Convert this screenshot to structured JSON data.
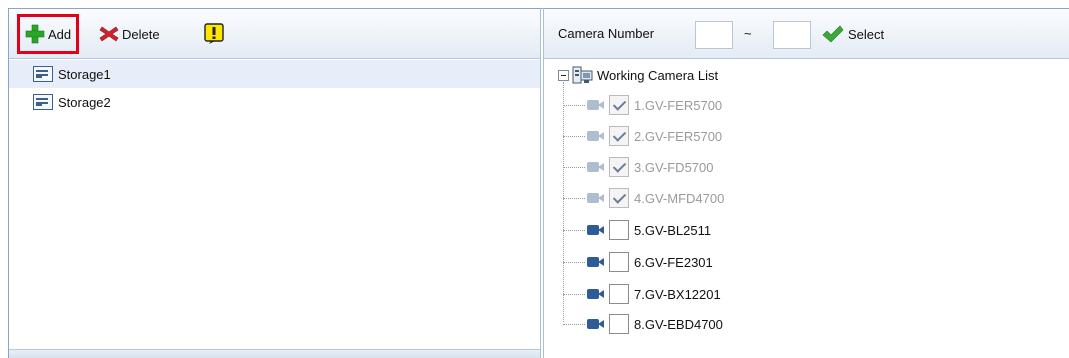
{
  "left_toolbar": {
    "add_label": "Add",
    "delete_label": "Delete",
    "add_icon": "plus-icon",
    "delete_icon": "delete-x-icon",
    "alert_icon": "exclamation-icon"
  },
  "storage_list": [
    {
      "label": "Storage1",
      "selected": true
    },
    {
      "label": "Storage2",
      "selected": false
    }
  ],
  "right_toolbar": {
    "camera_number_label": "Camera Number",
    "from_value": "",
    "to_value": "",
    "separator": "~",
    "select_label": "Select"
  },
  "camera_tree": {
    "root_label": "Working Camera List",
    "cameras": [
      {
        "label": "1.GV-FER5700",
        "checked": true,
        "disabled": true
      },
      {
        "label": "2.GV-FER5700",
        "checked": true,
        "disabled": true
      },
      {
        "label": "3.GV-FD5700",
        "checked": true,
        "disabled": true
      },
      {
        "label": "4.GV-MFD4700",
        "checked": true,
        "disabled": true
      },
      {
        "label": "5.GV-BL2511",
        "checked": false,
        "disabled": false
      },
      {
        "label": "6.GV-FE2301",
        "checked": false,
        "disabled": false
      },
      {
        "label": "7.GV-BX12201",
        "checked": false,
        "disabled": false
      },
      {
        "label": "8.GV-EBD4700",
        "checked": false,
        "disabled": false
      }
    ]
  },
  "colors": {
    "highlight_border": "#e3001b",
    "add_green": "#2aa52a",
    "delete_red": "#d0242c",
    "alert_yellow": "#ffe600",
    "select_check_green": "#3aa93a",
    "active_camera_blue": "#2f5c97"
  }
}
